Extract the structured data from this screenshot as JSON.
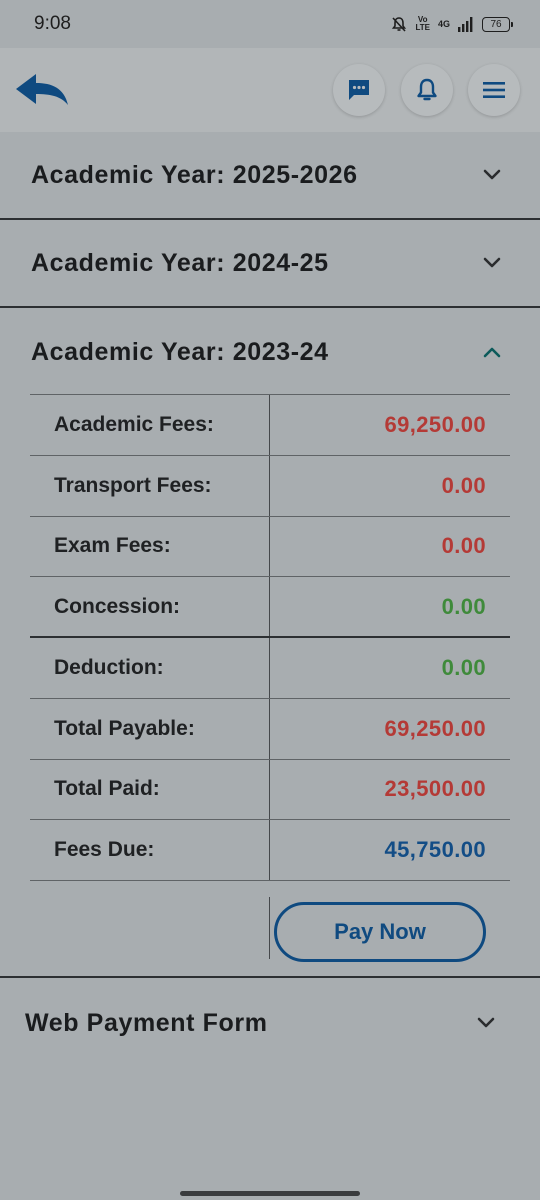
{
  "status_bar": {
    "time": "9:08",
    "volte": "Vo\nLTE",
    "network": "4G",
    "battery": "76"
  },
  "header": {
    "back_icon": "back-arrow-icon",
    "chat_icon": "chat-icon",
    "bell_icon": "bell-icon",
    "menu_icon": "hamburger-menu-icon"
  },
  "accordions": [
    {
      "title": "Academic Year: 2025-2026",
      "expanded": false
    },
    {
      "title": "Academic Year: 2024-25",
      "expanded": false
    },
    {
      "title": "Academic Year: 2023-24",
      "expanded": true
    }
  ],
  "fees": [
    {
      "label": "Academic Fees:",
      "value": "69,250.00",
      "color": "#b43a36"
    },
    {
      "label": "Transport Fees:",
      "value": "0.00",
      "color": "#b43a36"
    },
    {
      "label": "Exam Fees:",
      "value": "0.00",
      "color": "#b43a36"
    },
    {
      "label": "Concession:",
      "value": "0.00",
      "color": "#3f8a3b"
    },
    {
      "label": "Deduction:",
      "value": "0.00",
      "color": "#3f8a3b"
    },
    {
      "label": "Total Payable:",
      "value": "69,250.00",
      "color": "#b43a36"
    },
    {
      "label": "Total Paid:",
      "value": "23,500.00",
      "color": "#b43a36"
    },
    {
      "label": "Fees Due:",
      "value": "45,750.00",
      "color": "#134d86"
    }
  ],
  "pay_button": "Pay Now",
  "web_payment_form": {
    "title": "Web Payment Form",
    "expanded": false
  },
  "colors": {
    "accent": "#0f4a80",
    "chevron_up": "#0c5a5a"
  }
}
